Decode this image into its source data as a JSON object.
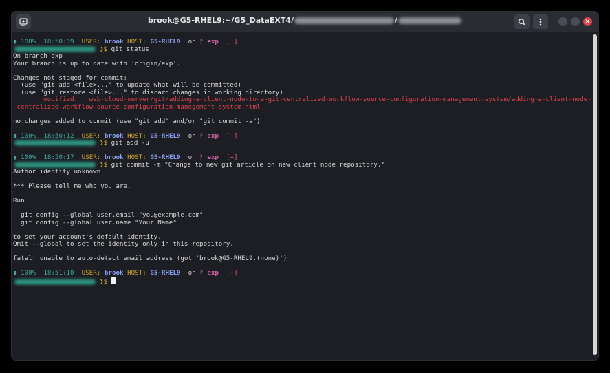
{
  "window": {
    "title_prefix": "brook@G5-RHEL9:~/G5_DataEXT4/",
    "title_sep": "/"
  },
  "colors": {
    "window_bg": "#1c1e24",
    "titlebar": "#2a2c33",
    "close": "#e0414b",
    "scrollbar": "#d6d6d6"
  },
  "icons": {
    "left": "terminal-icon",
    "search": "search-icon",
    "menu": "kebab-menu-icon"
  },
  "prompt": {
    "user_label": "USER:",
    "user": "brook",
    "host_label": "HOST:",
    "host": "G5-RHEL9",
    "on": "on",
    "branch_icon": "ᚹ",
    "branch": "exp",
    "dollar": "$",
    "battery": "100%",
    "indicator": "▮"
  },
  "blocks": [
    {
      "time": "18:50:09",
      "flag": "[!]",
      "command": "git status",
      "output": [
        {
          "text": "On branch exp"
        },
        {
          "text": "Your branch is up to date with 'origin/exp'."
        },
        {
          "text": ""
        },
        {
          "text": "Changes not staged for commit:"
        },
        {
          "text": "  (use \"git add <file>...\" to update what will be committed)"
        },
        {
          "text": "  (use \"git restore <file>...\" to discard changes in working directory)"
        },
        {
          "text": "        modified:   web-cloud-server/git/adding-a-client-node-to-a-git-centralized-workflow-source-configuration-management-system/adding-a-client-node-in-a-git",
          "cls": "mod"
        },
        {
          "text": "-centralized-workflow-source-configuration-manegement-system.html",
          "cls": "mod"
        },
        {
          "text": ""
        },
        {
          "text": "no changes added to commit (use \"git add\" and/or \"git commit -a\")"
        },
        {
          "text": ""
        }
      ]
    },
    {
      "time": "18:50:12",
      "flag": "[!]",
      "command": "git add -u",
      "output": [
        {
          "text": ""
        }
      ]
    },
    {
      "time": "18:50:17",
      "flag": "[+]",
      "command": "git commit -m \"Change to new git article on new client node repository.\"",
      "output": [
        {
          "text": "Author identity unknown"
        },
        {
          "text": ""
        },
        {
          "text": "*** Please tell me who you are."
        },
        {
          "text": ""
        },
        {
          "text": "Run"
        },
        {
          "text": ""
        },
        {
          "text": "  git config --global user.email \"you@example.com\""
        },
        {
          "text": "  git config --global user.name \"Your Name\""
        },
        {
          "text": ""
        },
        {
          "text": "to set your account's default identity."
        },
        {
          "text": "Omit --global to set the identity only in this repository."
        },
        {
          "text": ""
        },
        {
          "text": "fatal: unable to auto-detect email address (got 'brook@G5-RHEL9.(none)')"
        },
        {
          "text": ""
        }
      ]
    },
    {
      "time": "18:51:10",
      "flag": "[+]",
      "command": "",
      "output": []
    }
  ]
}
